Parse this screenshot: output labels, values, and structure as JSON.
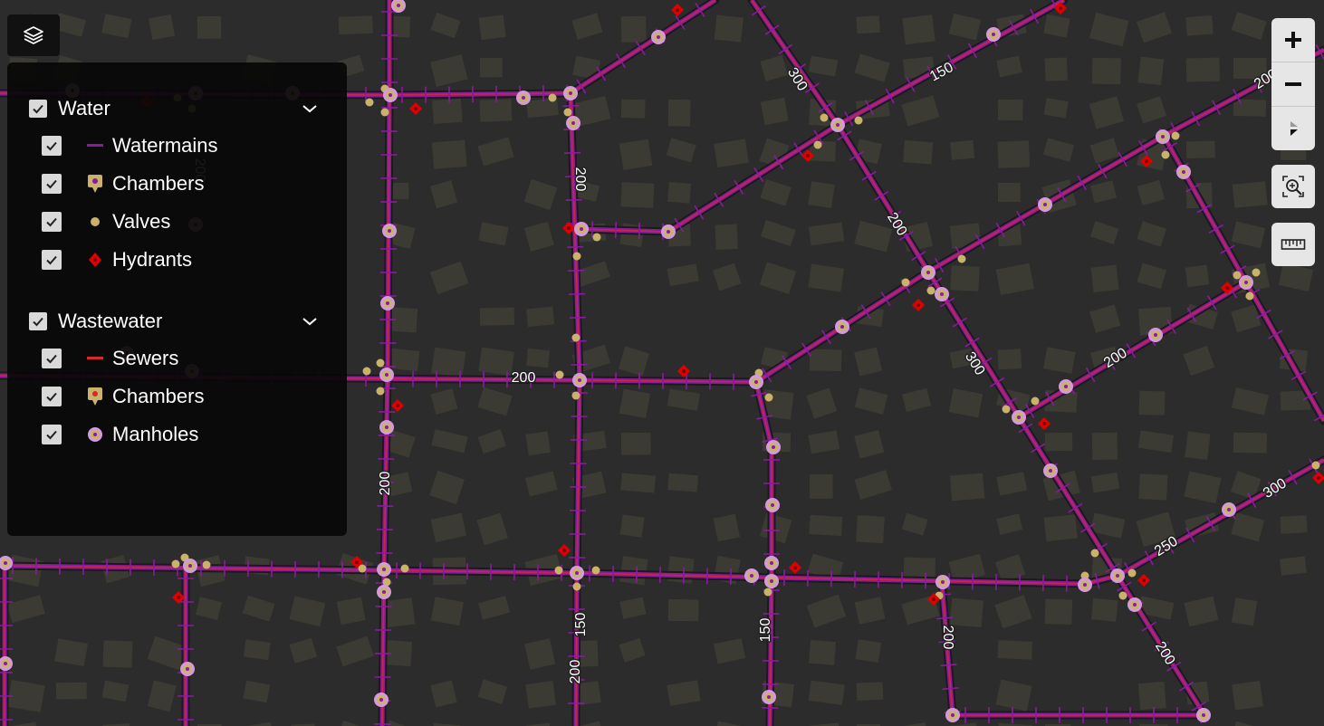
{
  "legend": {
    "groups": [
      {
        "label": "Water",
        "checked": true,
        "items": [
          {
            "label": "Watermains",
            "symbol": "line",
            "color": "#8b1aa0",
            "checked": true
          },
          {
            "label": "Chambers",
            "symbol": "chamber",
            "color": "#c9b36a",
            "checked": true
          },
          {
            "label": "Valves",
            "symbol": "dot",
            "color": "#c9b36a",
            "checked": true
          },
          {
            "label": "Hydrants",
            "symbol": "hydrant",
            "color": "#e00000",
            "checked": true
          }
        ]
      },
      {
        "label": "Wastewater",
        "checked": true,
        "items": [
          {
            "label": "Sewers",
            "symbol": "line",
            "color": "#d62828",
            "checked": true
          },
          {
            "label": "Chambers",
            "symbol": "chamber",
            "color": "#c9b36a",
            "checked": true
          },
          {
            "label": "Manholes",
            "symbol": "manhole",
            "color": "#d59ad8",
            "checked": true
          }
        ]
      }
    ]
  },
  "map": {
    "pipe_labels": [
      "300",
      "150",
      "200",
      "200",
      "200",
      "200",
      "300",
      "200",
      "200",
      "200",
      "150",
      "200",
      "150",
      "200",
      "200",
      "250",
      "300",
      "200"
    ]
  },
  "colors": {
    "watermain": "#8b1aa0",
    "sewer": "#c62a3a",
    "valve": "#c9b36a",
    "hydrant": "#e00000",
    "manhole": "#d59ad8",
    "building": "#3b3a33"
  },
  "controls": {
    "icons": [
      "zoom-in-icon",
      "zoom-out-icon",
      "compass-icon",
      "zoom-extent-icon",
      "ruler-icon"
    ]
  }
}
